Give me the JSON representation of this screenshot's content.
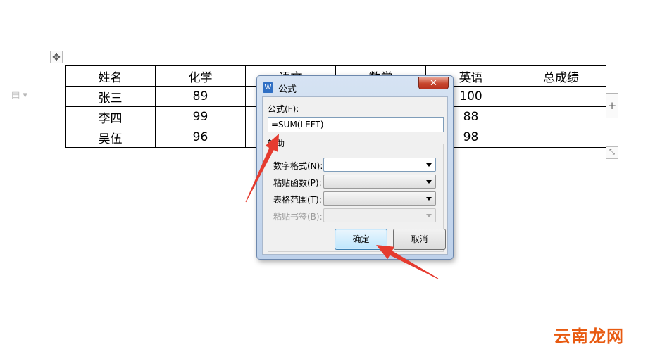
{
  "table": {
    "header": [
      "姓名",
      "化学",
      "语文",
      "数学",
      "英语",
      "总成绩"
    ],
    "rows": [
      [
        "张三",
        "89",
        "",
        "",
        "100",
        ""
      ],
      [
        "李四",
        "99",
        "",
        "",
        "88",
        ""
      ],
      [
        "吴伍",
        "96",
        "",
        "",
        "98",
        ""
      ]
    ]
  },
  "dialog": {
    "icon_glyph": "W",
    "title": "公式",
    "close_glyph": "✕",
    "formula_label": "公式(F):",
    "formula_value": "=SUM(LEFT)",
    "aux_label": "辅助",
    "number_format_label": "数字格式(N):",
    "number_format_value": "",
    "paste_function_label": "粘贴函数(P):",
    "paste_function_value": "",
    "table_range_label": "表格范围(T):",
    "table_range_value": "",
    "paste_bookmark_label": "粘贴书签(B):",
    "paste_bookmark_value": "",
    "ok_label": "确定",
    "cancel_label": "取消"
  },
  "controls": {
    "move_glyph": "✥",
    "add_column_glyph": "+",
    "resize_glyph": "⤡",
    "doc_glyph": "▤ ▾"
  },
  "annotation_color": "#e53b2f",
  "watermark": "云南龙网"
}
